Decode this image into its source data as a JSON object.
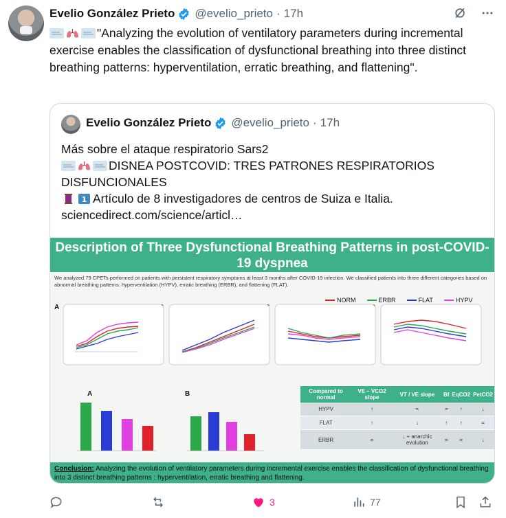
{
  "author": {
    "name": "Evelio González Prieto",
    "handle": "@evelio_prieto",
    "time": "17h"
  },
  "tweet": {
    "emoji": [
      "wind-face",
      "lungs",
      "wind-face"
    ],
    "text": "\"Analyzing the evolution of ventilatory parameters during incremental exercise enables the classification of dysfunctional breathing into three distinct breathing patterns: hyperventilation, erratic breathing, and flattening\"."
  },
  "quote": {
    "name": "Evelio González Prieto",
    "handle": "@evelio_prieto",
    "time": "17h",
    "line1": "Más sobre el ataque respiratorio Sars2",
    "line2": "DISNEA POSTCOVID: TRES PATRONES RESPIRATORIOS DISFUNCIONALES",
    "line3": "Artículo de 8 investigadores de centros de Suiza e Italia.",
    "link": "sciencedirect.com/science/articl…",
    "keycap": "1"
  },
  "infographic": {
    "title": "Description of Three Dysfunctional Breathing Patterns in post-COVID-19 dyspnea",
    "intro": "We analyzed 79 CPETs performed on patients with persistent respiratory symptoms at least 3 months after COVID-19 infection. We classified patients into three different categories based on abnormal breathing patterns: hyperventilation (HYPV), erratic breathing (ERBR), and flattening (FLAT).",
    "legend": [
      {
        "label": "NORM",
        "color": "#e0202a"
      },
      {
        "label": "ERBR",
        "color": "#2aa84a"
      },
      {
        "label": "FLAT",
        "color": "#2a3bd6"
      },
      {
        "label": "HYPV",
        "color": "#e040e0"
      }
    ],
    "panels": [
      "A",
      "B",
      "C",
      "D"
    ],
    "bar_panels": [
      "A",
      "B"
    ],
    "table": {
      "headers": [
        "Compared to normal",
        "VE – VCO2 slope",
        "VT / VE slope",
        "Bf",
        "EqCO2",
        "PetCO2"
      ],
      "rows": [
        [
          "HYPV",
          "↑",
          "=",
          "=",
          "↑",
          "↓"
        ],
        [
          "FLAT",
          "↑",
          "↓",
          "↑",
          "↑",
          "="
        ],
        [
          "ERBR",
          "=",
          "↓ + anarchic evolution",
          "=",
          "=",
          "↓"
        ]
      ]
    },
    "conclusion_label": "Conclusion:",
    "conclusion": "Analyzing the evolution of ventilatory parameters during incremental exercise enables the classification of dysfunctional breathing into 3 distinct breathing patterns : hyperventilation, erratic breathing and flattening."
  },
  "actions": {
    "likes": "3",
    "views": "77",
    "like_color": "#f91880"
  }
}
